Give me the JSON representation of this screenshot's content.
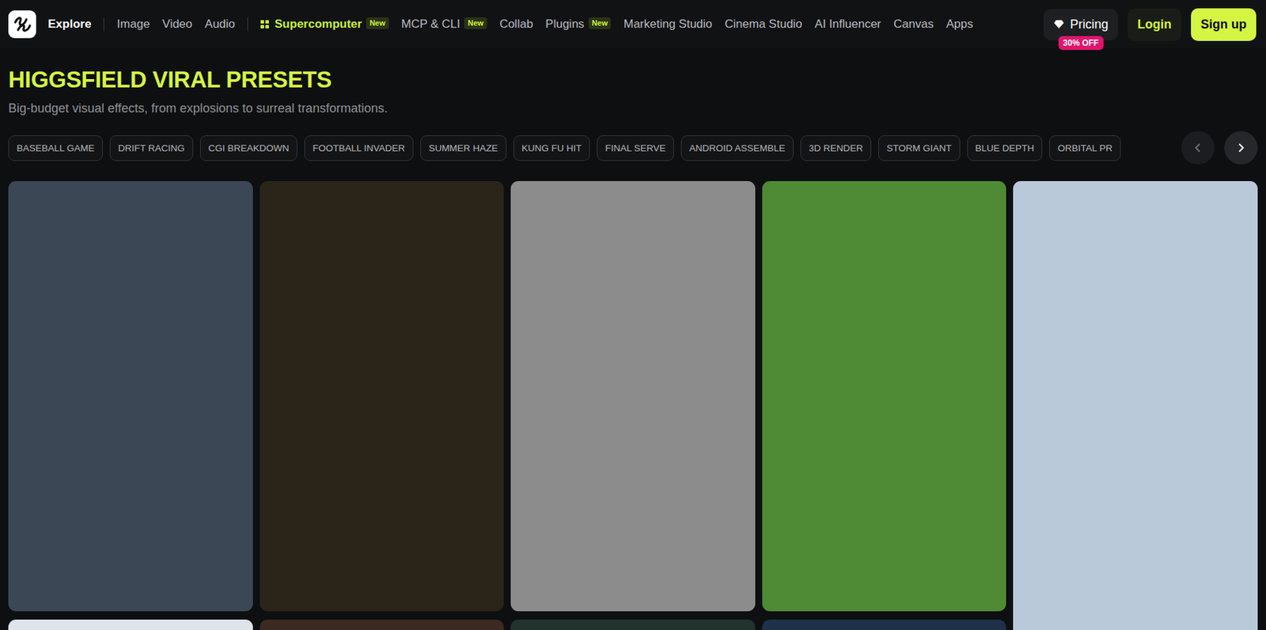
{
  "nav": {
    "groups": [
      [
        {
          "label": "Explore",
          "selected": true,
          "featured": false,
          "badge": ""
        }
      ],
      [
        {
          "label": "Image",
          "selected": false,
          "featured": false,
          "badge": ""
        },
        {
          "label": "Video",
          "selected": false,
          "featured": false,
          "badge": ""
        },
        {
          "label": "Audio",
          "selected": false,
          "featured": false,
          "badge": ""
        }
      ],
      [
        {
          "label": "Supercomputer",
          "selected": false,
          "featured": true,
          "badge": "New"
        },
        {
          "label": "MCP & CLI",
          "selected": false,
          "featured": false,
          "badge": "New"
        },
        {
          "label": "Collab",
          "selected": false,
          "featured": false,
          "badge": ""
        },
        {
          "label": "Plugins",
          "selected": false,
          "featured": false,
          "badge": "New"
        },
        {
          "label": "Marketing Studio",
          "selected": false,
          "featured": false,
          "badge": ""
        },
        {
          "label": "Cinema Studio",
          "selected": false,
          "featured": false,
          "badge": ""
        },
        {
          "label": "AI Influencer",
          "selected": false,
          "featured": false,
          "badge": ""
        },
        {
          "label": "Canvas",
          "selected": false,
          "featured": false,
          "badge": ""
        },
        {
          "label": "Apps",
          "selected": false,
          "featured": false,
          "badge": ""
        }
      ]
    ],
    "pricing": {
      "label": "Pricing",
      "badge": "30% OFF"
    },
    "login": "Login",
    "signup": "Sign up"
  },
  "header": {
    "title": "HIGGSFIELD VIRAL PRESETS",
    "subtitle": "Big-budget visual effects, from explosions to surreal transformations."
  },
  "chips": [
    {
      "label": "BASEBALL GAME",
      "selected": false
    },
    {
      "label": "DRIFT RACING",
      "selected": false
    },
    {
      "label": "CGI BREAKDOWN",
      "selected": false
    },
    {
      "label": "FOOTBALL INVADER",
      "selected": false
    },
    {
      "label": "SUMMER HAZE",
      "selected": false
    },
    {
      "label": "KUNG FU HIT",
      "selected": false
    },
    {
      "label": "FINAL SERVE",
      "selected": false
    },
    {
      "label": "ANDROID ASSEMBLE",
      "selected": false
    },
    {
      "label": "3D RENDER",
      "selected": false
    },
    {
      "label": "STORM GIANT",
      "selected": false
    },
    {
      "label": "BLUE DEPTH",
      "selected": false
    },
    {
      "label": "ORBITAL PR",
      "selected": false
    }
  ],
  "carousel": {
    "prev_disabled": true,
    "next_disabled": false
  },
  "columns": [
    [
      {
        "color": "#3c4756"
      },
      {
        "color": "#dfe4ea"
      }
    ],
    [
      {
        "color": "#2b2418"
      },
      {
        "color": "#3a2a22"
      }
    ],
    [
      {
        "color": "#8c8c8c"
      },
      {
        "color": "#22332d"
      }
    ],
    [
      {
        "color": "#4f8a35"
      },
      {
        "color": "#1f3148"
      }
    ],
    [
      {
        "color": "#b9c9d9"
      }
    ]
  ]
}
